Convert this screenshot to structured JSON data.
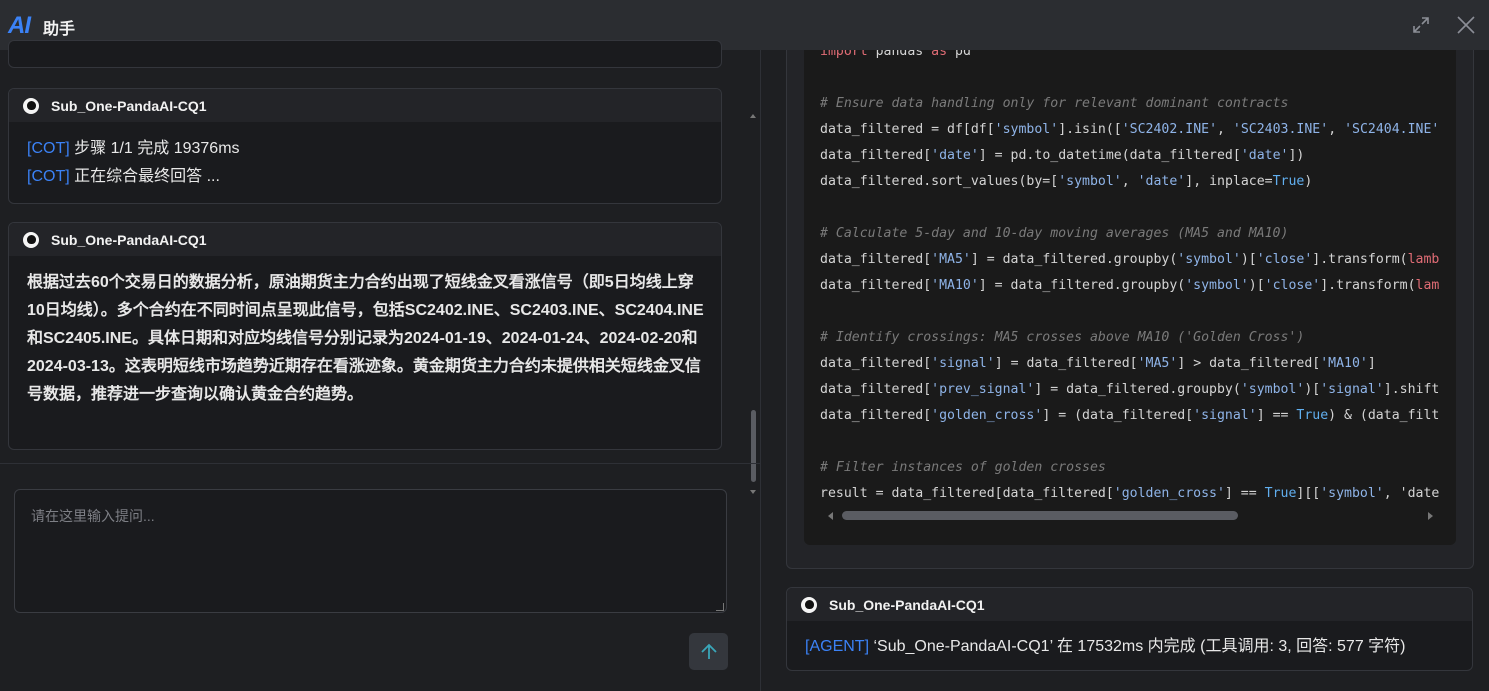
{
  "header": {
    "logo_text": "AI",
    "title": "助手"
  },
  "cards": [
    {
      "agent": "Sub_One-PandaAI-CQ1",
      "lines": [
        {
          "tag": "[COT]",
          "text": " 步骤 1/1 完成 19376ms"
        },
        {
          "tag": "[COT]",
          "text": " 正在综合最终回答 ..."
        }
      ]
    },
    {
      "agent": "Sub_One-PandaAI-CQ1",
      "body": "根据过去60个交易日的数据分析，原油期货主力合约出现了短线金叉看涨信号（即5日均线上穿10日均线）。多个合约在不同时间点呈现此信号，包括SC2402.INE、SC2403.INE、SC2404.INE和SC2405.INE。具体日期和对应均线信号分别记录为2024-01-19、2024-01-24、2024-02-20和2024-03-13。这表明短线市场趋势近期存在看涨迹象。黄金期货主力合约未提供相关短线金叉信号数据，推荐进一步查询以确认黄金合约趋势。"
    }
  ],
  "input": {
    "placeholder": "请在这里输入提问..."
  },
  "code_lines": [
    "import pandas as pd",
    "",
    "# Ensure data handling only for relevant dominant contracts",
    "data_filtered = df[df['symbol'].isin(['SC2402.INE', 'SC2403.INE', 'SC2404.INE'",
    "data_filtered['date'] = pd.to_datetime(data_filtered['date'])",
    "data_filtered.sort_values(by=['symbol', 'date'], inplace=True)",
    "",
    "# Calculate 5-day and 10-day moving averages (MA5 and MA10)",
    "data_filtered['MA5'] = data_filtered.groupby('symbol')['close'].transform(lamb",
    "data_filtered['MA10'] = data_filtered.groupby('symbol')['close'].transform(lam",
    "",
    "# Identify crossings: MA5 crosses above MA10 ('Golden Cross')",
    "data_filtered['signal'] = data_filtered['MA5'] > data_filtered['MA10']",
    "data_filtered['prev_signal'] = data_filtered.groupby('symbol')['signal'].shift",
    "data_filtered['golden_cross'] = (data_filtered['signal'] == True) & (data_filt",
    "",
    "# Filter instances of golden crosses",
    "result = data_filtered[data_filtered['golden_cross'] == True][['symbol', 'date"
  ],
  "result_card": {
    "agent": "Sub_One-PandaAI-CQ1",
    "tag": "[AGENT]",
    "text": " ‘Sub_One-PandaAI-CQ1’ 在 17532ms 内完成 (工具调用: 3, 回答: 577 字符)"
  },
  "colors": {
    "accent": "#3b82f6",
    "background": "#1e1f22",
    "code_bg": "#1a1a1a"
  },
  "icons": {
    "expand": "expand-icon",
    "close": "close-icon",
    "send": "arrow-up-icon",
    "avatar": "panda-avatar-icon"
  }
}
